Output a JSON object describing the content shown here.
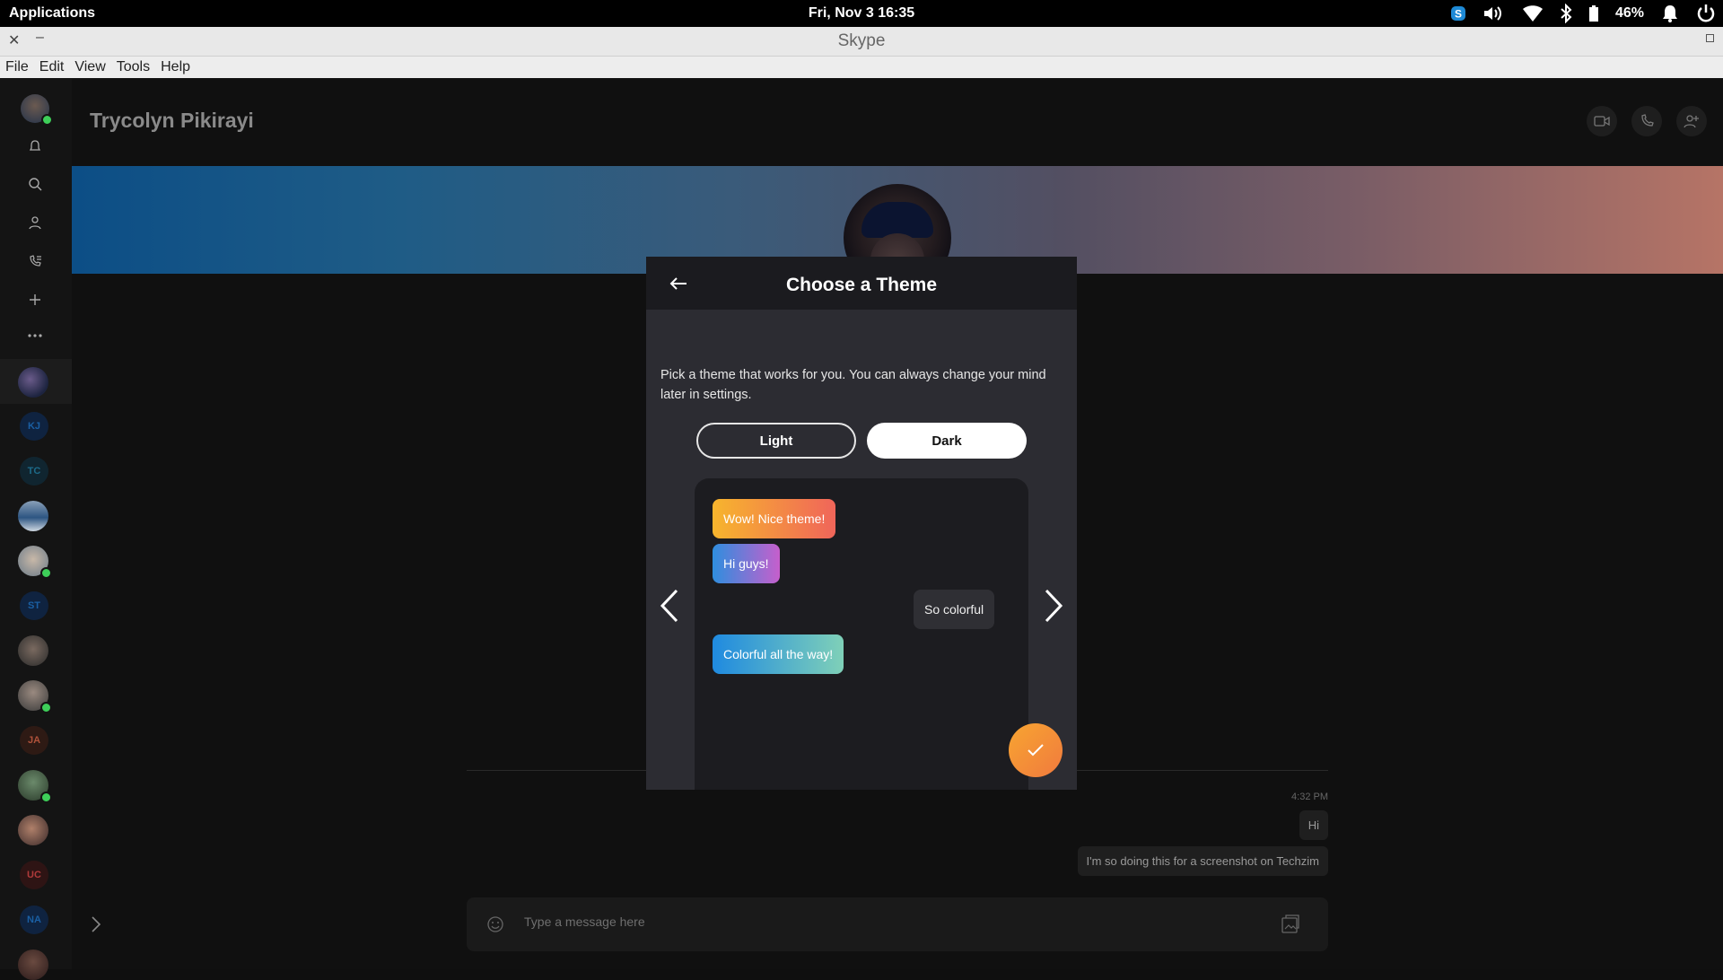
{
  "system_bar": {
    "applications": "Applications",
    "clock": "Fri, Nov  3   16:35",
    "battery": "46%"
  },
  "window": {
    "title": "Skype"
  },
  "menu": [
    "File",
    "Edit",
    "View",
    "Tools",
    "Help"
  ],
  "sidebar": {
    "initials": [
      "KJ",
      "TC",
      "ST",
      "JA",
      "UC",
      "NA"
    ]
  },
  "chat": {
    "contact_name": "Trycolyn Pikirayi",
    "time": "4:32 PM",
    "messages": [
      "Hi",
      "I'm so doing this for a screenshot on Techzim"
    ],
    "composer_placeholder": "Type a message here"
  },
  "dialog": {
    "title": "Choose a Theme",
    "description": "Pick a theme that works for you. You can always change your mind later in settings.",
    "options": [
      "Light",
      "Dark"
    ],
    "selected": "Dark",
    "preview_messages": [
      "Wow! Nice theme!",
      "Hi guys!",
      "So colorful",
      "Colorful all the way!"
    ]
  },
  "colors": {
    "accent_orange": "#f8a531",
    "online": "#3ecf59",
    "banner_left": "#0c4e86",
    "banner_right": "#b67466"
  }
}
